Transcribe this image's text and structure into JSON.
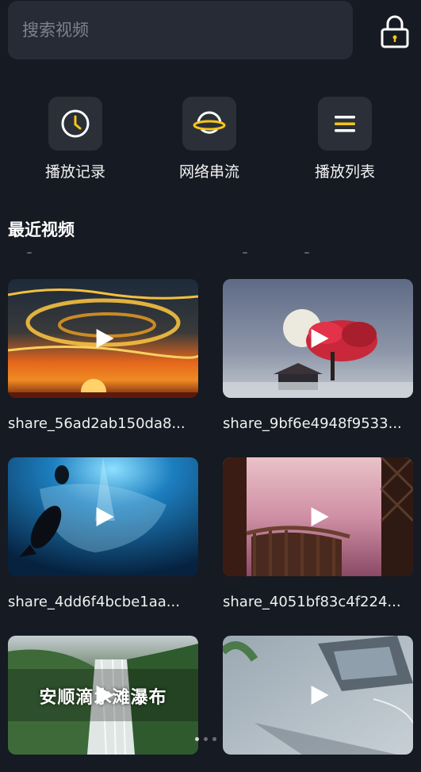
{
  "search": {
    "placeholder": "搜索视频"
  },
  "quick_actions": [
    {
      "label": "播放记录",
      "icon": "clock-icon"
    },
    {
      "label": "网络串流",
      "icon": "planet-icon"
    },
    {
      "label": "播放列表",
      "icon": "list-icon"
    }
  ],
  "section": {
    "title": "最近视频"
  },
  "videos": [
    {
      "title": "share_56ad2ab150da8...",
      "overlay": ""
    },
    {
      "title": "share_9bf6e4948f9533...",
      "overlay": ""
    },
    {
      "title": "share_4dd6f4bcbe1aa...",
      "overlay": ""
    },
    {
      "title": "share_4051bf83c4f224...",
      "overlay": ""
    },
    {
      "title": "",
      "overlay": "安顺滴水滩瀑布"
    },
    {
      "title": "",
      "overlay": ""
    }
  ],
  "colors": {
    "background": "#161a22",
    "accent": "#f5c518",
    "card_bg": "#2a2f38"
  }
}
